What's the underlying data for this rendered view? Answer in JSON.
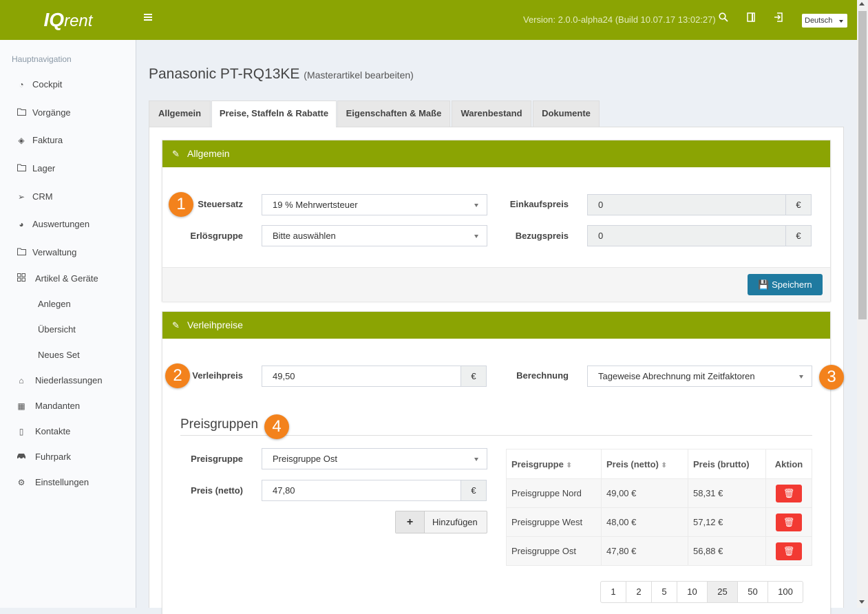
{
  "app": {
    "logo_main": "IQ",
    "logo_sub": "rent"
  },
  "topbar": {
    "version": "Version: 2.0.0-alpha24 (Build 10.07.17 13:02:27)",
    "language": "Deutsch"
  },
  "sidebar": {
    "header": "Hauptnavigation",
    "items": [
      {
        "label": "Cockpit",
        "icon": "dashboard-icon"
      },
      {
        "label": "Vorgänge",
        "icon": "folder-icon"
      },
      {
        "label": "Faktura",
        "icon": "layers-icon"
      },
      {
        "label": "Lager",
        "icon": "folder-icon"
      },
      {
        "label": "CRM",
        "icon": "paper-plane-icon"
      },
      {
        "label": "Auswertungen",
        "icon": "pie-chart-icon"
      },
      {
        "label": "Verwaltung",
        "icon": "folder-icon"
      },
      {
        "label": "Artikel & Geräte",
        "icon": "grid-icon"
      },
      {
        "label": "Anlegen"
      },
      {
        "label": "Übersicht"
      },
      {
        "label": "Neues Set"
      },
      {
        "label": "Niederlassungen",
        "icon": "home-icon"
      },
      {
        "label": "Mandanten",
        "icon": "building-icon"
      },
      {
        "label": "Kontakte",
        "icon": "address-book-icon"
      },
      {
        "label": "Fuhrpark",
        "icon": "car-icon"
      },
      {
        "label": "Einstellungen",
        "icon": "cogs-icon"
      }
    ]
  },
  "page": {
    "title": "Panasonic PT-RQ13KE",
    "subtitle": "(Masterartikel bearbeiten)",
    "tabs": [
      {
        "label": "Allgemein"
      },
      {
        "label": "Preise, Staffeln & Rabatte"
      },
      {
        "label": "Eigenschaften & Maße"
      },
      {
        "label": "Warenbestand"
      },
      {
        "label": "Dokumente"
      }
    ]
  },
  "allgemein": {
    "header": "Allgemein",
    "steuersatz_label": "Steuersatz",
    "steuersatz_value": "19 % Mehrwertsteuer",
    "erloesgruppe_label": "Erlösgruppe",
    "erloesgruppe_value": "Bitte auswählen",
    "einkaufspreis_label": "Einkaufspreis",
    "einkaufspreis_value": "0",
    "bezugspreis_label": "Bezugspreis",
    "bezugspreis_value": "0",
    "currency": "€",
    "save_label": "Speichern"
  },
  "verleih": {
    "header": "Verleihpreise",
    "verleihpreis_label": "Verleihpreis",
    "verleihpreis_value": "49,50",
    "berechnung_label": "Berechnung",
    "berechnung_value": "Tageweise Abrechnung mit Zeitfaktoren",
    "currency": "€"
  },
  "preisgruppen": {
    "title": "Preisgruppen",
    "gruppe_label": "Preisgruppe",
    "gruppe_value": "Preisgruppe Ost",
    "preis_label": "Preis (netto)",
    "preis_value": "47,80",
    "currency": "€",
    "add_label": "Hinzufügen",
    "table": {
      "headers": [
        "Preisgruppe",
        "Preis (netto)",
        "Preis (brutto)",
        "Aktion"
      ],
      "rows": [
        {
          "gruppe": "Preisgruppe Nord",
          "netto": "49,00 €",
          "brutto": "58,31 €"
        },
        {
          "gruppe": "Preisgruppe West",
          "netto": "48,00 €",
          "brutto": "57,12 €"
        },
        {
          "gruppe": "Preisgruppe Ost",
          "netto": "47,80 €",
          "brutto": "56,88 €"
        }
      ]
    },
    "page_sizes": [
      "1",
      "2",
      "5",
      "10",
      "25",
      "50",
      "100"
    ],
    "active_page_size": "25"
  },
  "badges": [
    "1",
    "2",
    "3",
    "4"
  ],
  "colors": {
    "brand": "#8ba403",
    "primary_button": "#1f7aa0",
    "danger": "#f23a33",
    "badge": "#f3821c"
  }
}
